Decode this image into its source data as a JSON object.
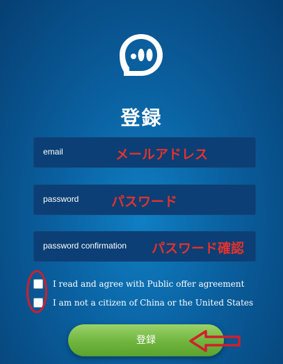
{
  "title": "登録",
  "fields": {
    "email": {
      "placeholder": "email",
      "annotation": "メールアドレス"
    },
    "password": {
      "placeholder": "password",
      "annotation": "パスワード"
    },
    "password_confirmation": {
      "placeholder": "password confirmation",
      "annotation": "パスワード確認"
    }
  },
  "checkboxes": [
    {
      "label": "I read and agree with Public offer agreement",
      "checked": false
    },
    {
      "label": "I am not a citizen of China or the United States",
      "checked": false
    }
  ],
  "submit_label": "登録",
  "colors": {
    "background": "#0a5f9e",
    "field": "#0b3f75",
    "annotation": "#e4322d",
    "button": "#6fb53d"
  },
  "icons": {
    "logo": "chat-bubble-icon",
    "arrow": "left-arrow-icon"
  }
}
